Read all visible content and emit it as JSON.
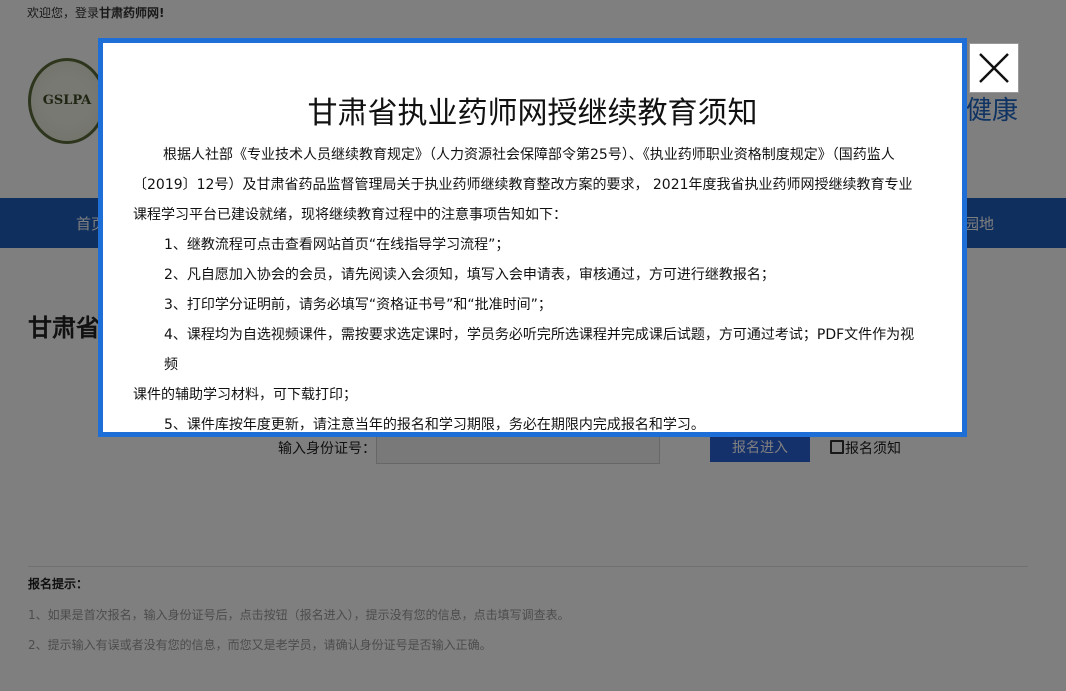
{
  "topbar": {
    "welcome": "欢迎您，登录",
    "site_name": "甘肃药师网!"
  },
  "header": {
    "logo_text": "GSLPA",
    "slogan": "健康"
  },
  "nav": {
    "first": "首页",
    "last": "园地"
  },
  "page": {
    "title": "甘肃省",
    "id_label": "输入身份证号：",
    "id_value": "",
    "enroll_button": "报名进入",
    "notice_link": "报名须知"
  },
  "tips": {
    "title": "报名提示：",
    "items": [
      "1、如果是首次报名，输入身份证号后，点击按钮（报名进入），提示没有您的信息，点击填写调查表。",
      "2、提示输入有误或者没有您的信息，而您又是老学员，请确认身份证号是否输入正确。"
    ]
  },
  "modal": {
    "title": "甘肃省执业药师网授继续教育须知",
    "intro": "根据人社部《专业技术人员继续教育规定》（人力资源社会保障部令第25号）、《执业药师职业资格制度规定》（国药监人〔2019〕12号）及甘肃省药品监督管理局关于执业药师继续教育整改方案的要求， 2021年度我省执业药师网授继续教育专业课程学习平台已建设就绪，现将继续教育过程中的注意事项告知如下：",
    "items": [
      "1、继教流程可点击查看网站首页“在线指导学习流程”；",
      "2、凡自愿加入协会的会员，请先阅读入会须知，填写入会申请表，审核通过，方可进行继教报名；",
      "3、打印学分证明前，请务必填写“资格证书号”和“批准时间”；",
      "4、课程均为自选视频课件，需按要求选定课时，学员务必听完所选课程并完成课后试题，方可通过考试；PDF文件作为视频",
      "课件的辅助学习材料，可下载打印；",
      "5、课件库按年度更新，请注意当年的报名和学习期限，务必在期限内完成报名和学习。"
    ]
  },
  "colors": {
    "modal_border": "#1d6ed6",
    "nav_bg": "#1f5fbf",
    "button_bg": "#2a62d8"
  },
  "icons": {
    "close": "close-icon",
    "book": "book-icon"
  }
}
